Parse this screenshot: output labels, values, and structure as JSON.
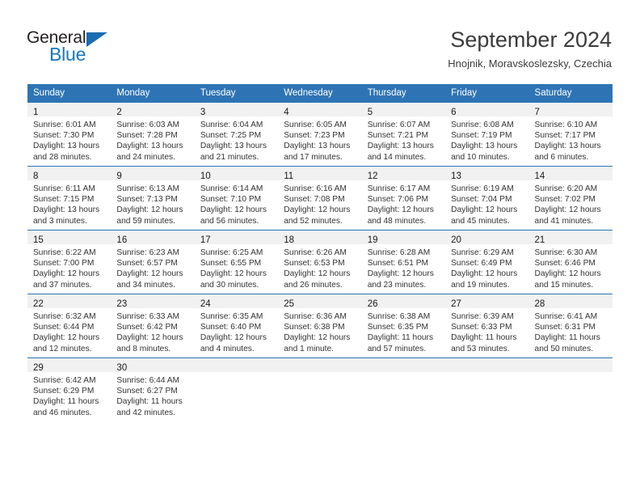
{
  "brand": {
    "word_one": "General",
    "word_two": "Blue",
    "triangle_icon": "triangle-icon",
    "accent_color": "#1878c0",
    "dark_color": "#231f20"
  },
  "header": {
    "title": "September 2024",
    "subtitle": "Hnojnik, Moravskoslezsky, Czechia"
  },
  "calendar": {
    "header_bg": "#2e74b5",
    "daynum_bg": "#f1f1f1",
    "weekdays": [
      "Sunday",
      "Monday",
      "Tuesday",
      "Wednesday",
      "Thursday",
      "Friday",
      "Saturday"
    ],
    "weeks": [
      [
        {
          "day": "1",
          "sunrise": "Sunrise: 6:01 AM",
          "sunset": "Sunset: 7:30 PM",
          "daylight_line1": "Daylight: 13 hours",
          "daylight_line2": "and 28 minutes."
        },
        {
          "day": "2",
          "sunrise": "Sunrise: 6:03 AM",
          "sunset": "Sunset: 7:28 PM",
          "daylight_line1": "Daylight: 13 hours",
          "daylight_line2": "and 24 minutes."
        },
        {
          "day": "3",
          "sunrise": "Sunrise: 6:04 AM",
          "sunset": "Sunset: 7:25 PM",
          "daylight_line1": "Daylight: 13 hours",
          "daylight_line2": "and 21 minutes."
        },
        {
          "day": "4",
          "sunrise": "Sunrise: 6:05 AM",
          "sunset": "Sunset: 7:23 PM",
          "daylight_line1": "Daylight: 13 hours",
          "daylight_line2": "and 17 minutes."
        },
        {
          "day": "5",
          "sunrise": "Sunrise: 6:07 AM",
          "sunset": "Sunset: 7:21 PM",
          "daylight_line1": "Daylight: 13 hours",
          "daylight_line2": "and 14 minutes."
        },
        {
          "day": "6",
          "sunrise": "Sunrise: 6:08 AM",
          "sunset": "Sunset: 7:19 PM",
          "daylight_line1": "Daylight: 13 hours",
          "daylight_line2": "and 10 minutes."
        },
        {
          "day": "7",
          "sunrise": "Sunrise: 6:10 AM",
          "sunset": "Sunset: 7:17 PM",
          "daylight_line1": "Daylight: 13 hours",
          "daylight_line2": "and 6 minutes."
        }
      ],
      [
        {
          "day": "8",
          "sunrise": "Sunrise: 6:11 AM",
          "sunset": "Sunset: 7:15 PM",
          "daylight_line1": "Daylight: 13 hours",
          "daylight_line2": "and 3 minutes."
        },
        {
          "day": "9",
          "sunrise": "Sunrise: 6:13 AM",
          "sunset": "Sunset: 7:13 PM",
          "daylight_line1": "Daylight: 12 hours",
          "daylight_line2": "and 59 minutes."
        },
        {
          "day": "10",
          "sunrise": "Sunrise: 6:14 AM",
          "sunset": "Sunset: 7:10 PM",
          "daylight_line1": "Daylight: 12 hours",
          "daylight_line2": "and 56 minutes."
        },
        {
          "day": "11",
          "sunrise": "Sunrise: 6:16 AM",
          "sunset": "Sunset: 7:08 PM",
          "daylight_line1": "Daylight: 12 hours",
          "daylight_line2": "and 52 minutes."
        },
        {
          "day": "12",
          "sunrise": "Sunrise: 6:17 AM",
          "sunset": "Sunset: 7:06 PM",
          "daylight_line1": "Daylight: 12 hours",
          "daylight_line2": "and 48 minutes."
        },
        {
          "day": "13",
          "sunrise": "Sunrise: 6:19 AM",
          "sunset": "Sunset: 7:04 PM",
          "daylight_line1": "Daylight: 12 hours",
          "daylight_line2": "and 45 minutes."
        },
        {
          "day": "14",
          "sunrise": "Sunrise: 6:20 AM",
          "sunset": "Sunset: 7:02 PM",
          "daylight_line1": "Daylight: 12 hours",
          "daylight_line2": "and 41 minutes."
        }
      ],
      [
        {
          "day": "15",
          "sunrise": "Sunrise: 6:22 AM",
          "sunset": "Sunset: 7:00 PM",
          "daylight_line1": "Daylight: 12 hours",
          "daylight_line2": "and 37 minutes."
        },
        {
          "day": "16",
          "sunrise": "Sunrise: 6:23 AM",
          "sunset": "Sunset: 6:57 PM",
          "daylight_line1": "Daylight: 12 hours",
          "daylight_line2": "and 34 minutes."
        },
        {
          "day": "17",
          "sunrise": "Sunrise: 6:25 AM",
          "sunset": "Sunset: 6:55 PM",
          "daylight_line1": "Daylight: 12 hours",
          "daylight_line2": "and 30 minutes."
        },
        {
          "day": "18",
          "sunrise": "Sunrise: 6:26 AM",
          "sunset": "Sunset: 6:53 PM",
          "daylight_line1": "Daylight: 12 hours",
          "daylight_line2": "and 26 minutes."
        },
        {
          "day": "19",
          "sunrise": "Sunrise: 6:28 AM",
          "sunset": "Sunset: 6:51 PM",
          "daylight_line1": "Daylight: 12 hours",
          "daylight_line2": "and 23 minutes."
        },
        {
          "day": "20",
          "sunrise": "Sunrise: 6:29 AM",
          "sunset": "Sunset: 6:49 PM",
          "daylight_line1": "Daylight: 12 hours",
          "daylight_line2": "and 19 minutes."
        },
        {
          "day": "21",
          "sunrise": "Sunrise: 6:30 AM",
          "sunset": "Sunset: 6:46 PM",
          "daylight_line1": "Daylight: 12 hours",
          "daylight_line2": "and 15 minutes."
        }
      ],
      [
        {
          "day": "22",
          "sunrise": "Sunrise: 6:32 AM",
          "sunset": "Sunset: 6:44 PM",
          "daylight_line1": "Daylight: 12 hours",
          "daylight_line2": "and 12 minutes."
        },
        {
          "day": "23",
          "sunrise": "Sunrise: 6:33 AM",
          "sunset": "Sunset: 6:42 PM",
          "daylight_line1": "Daylight: 12 hours",
          "daylight_line2": "and 8 minutes."
        },
        {
          "day": "24",
          "sunrise": "Sunrise: 6:35 AM",
          "sunset": "Sunset: 6:40 PM",
          "daylight_line1": "Daylight: 12 hours",
          "daylight_line2": "and 4 minutes."
        },
        {
          "day": "25",
          "sunrise": "Sunrise: 6:36 AM",
          "sunset": "Sunset: 6:38 PM",
          "daylight_line1": "Daylight: 12 hours",
          "daylight_line2": "and 1 minute."
        },
        {
          "day": "26",
          "sunrise": "Sunrise: 6:38 AM",
          "sunset": "Sunset: 6:35 PM",
          "daylight_line1": "Daylight: 11 hours",
          "daylight_line2": "and 57 minutes."
        },
        {
          "day": "27",
          "sunrise": "Sunrise: 6:39 AM",
          "sunset": "Sunset: 6:33 PM",
          "daylight_line1": "Daylight: 11 hours",
          "daylight_line2": "and 53 minutes."
        },
        {
          "day": "28",
          "sunrise": "Sunrise: 6:41 AM",
          "sunset": "Sunset: 6:31 PM",
          "daylight_line1": "Daylight: 11 hours",
          "daylight_line2": "and 50 minutes."
        }
      ],
      [
        {
          "day": "29",
          "sunrise": "Sunrise: 6:42 AM",
          "sunset": "Sunset: 6:29 PM",
          "daylight_line1": "Daylight: 11 hours",
          "daylight_line2": "and 46 minutes."
        },
        {
          "day": "30",
          "sunrise": "Sunrise: 6:44 AM",
          "sunset": "Sunset: 6:27 PM",
          "daylight_line1": "Daylight: 11 hours",
          "daylight_line2": "and 42 minutes."
        },
        {
          "day": "",
          "sunrise": "",
          "sunset": "",
          "daylight_line1": "",
          "daylight_line2": ""
        },
        {
          "day": "",
          "sunrise": "",
          "sunset": "",
          "daylight_line1": "",
          "daylight_line2": ""
        },
        {
          "day": "",
          "sunrise": "",
          "sunset": "",
          "daylight_line1": "",
          "daylight_line2": ""
        },
        {
          "day": "",
          "sunrise": "",
          "sunset": "",
          "daylight_line1": "",
          "daylight_line2": ""
        },
        {
          "day": "",
          "sunrise": "",
          "sunset": "",
          "daylight_line1": "",
          "daylight_line2": ""
        }
      ]
    ]
  }
}
